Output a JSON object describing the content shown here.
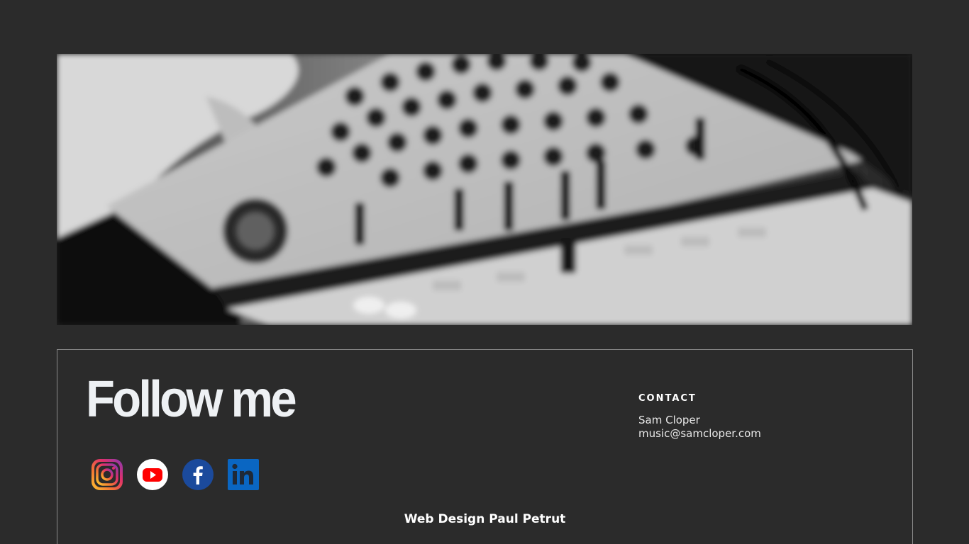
{
  "hero": {
    "image": "blurred-black-and-white-dj-mixer-photo"
  },
  "footer": {
    "title": "Follow me",
    "socials": [
      {
        "name": "instagram-icon",
        "label": "Instagram"
      },
      {
        "name": "youtube-icon",
        "label": "YouTube"
      },
      {
        "name": "facebook-icon",
        "label": "Facebook"
      },
      {
        "name": "linkedin-icon",
        "label": "LinkedIn"
      }
    ],
    "contact": {
      "heading": "CONTACT",
      "name": "Sam Cloper",
      "email": "music@samcloper.com"
    },
    "credit": "Web Design Paul Petrut"
  },
  "colors": {
    "background": "#2b2b2b",
    "title": "#eef1f4",
    "border": "#8a8a8a",
    "youtube": "#ff0000",
    "facebook": "#1877f2",
    "linkedin": "#0a66c2"
  }
}
